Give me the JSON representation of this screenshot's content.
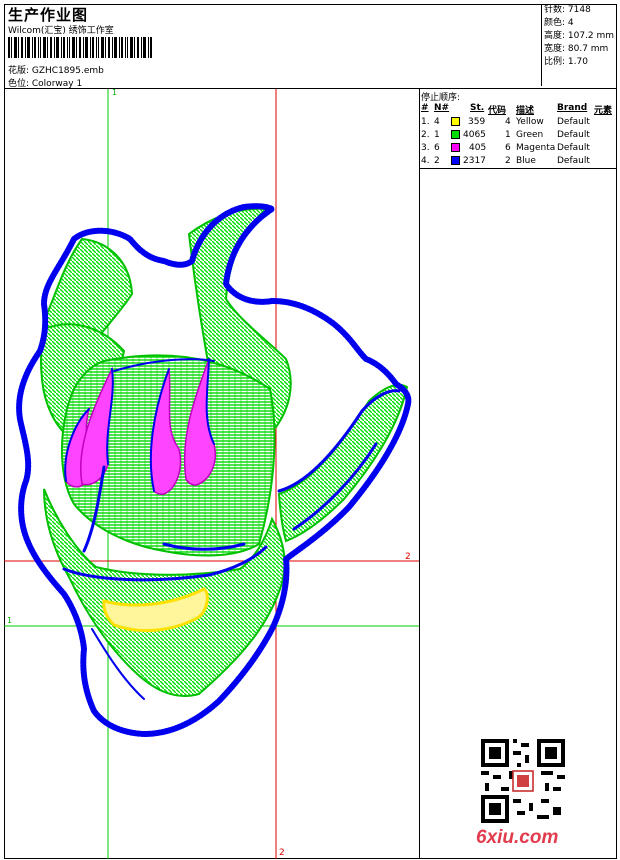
{
  "header": {
    "title": "生产作业图",
    "subtitle": "Wilcom(汇宝) 绣饰工作室",
    "design_label": "花版: GZHC1895.emb",
    "colorway_label": "色位: Colorway 1"
  },
  "stats": {
    "stitches": "针数: 7148",
    "colors": "颜色: 4",
    "height": "高度: 107.2 mm",
    "width": "宽度: 80.7 mm",
    "scale": "比例: 1.70"
  },
  "stop_sequence": {
    "title": "停止顺序:",
    "headers": [
      "#",
      "N#",
      "St.",
      "代码",
      "描述",
      "Brand",
      "元素"
    ],
    "rows": [
      {
        "idx": "1.",
        "needle": "4",
        "color": "#ffff00",
        "stitches": "359",
        "code": "4",
        "desc": "Yellow",
        "brand": "Default"
      },
      {
        "idx": "2.",
        "needle": "1",
        "color": "#00dd00",
        "stitches": "4065",
        "code": "1",
        "desc": "Green",
        "brand": "Default"
      },
      {
        "idx": "3.",
        "needle": "6",
        "color": "#ff00ff",
        "stitches": "405",
        "code": "6",
        "desc": "Magenta",
        "brand": "Default"
      },
      {
        "idx": "4.",
        "needle": "2",
        "color": "#0000ff",
        "stitches": "2317",
        "code": "2",
        "desc": "Blue",
        "brand": "Default"
      }
    ]
  },
  "guides": {
    "label_1": "1",
    "label_2": "2"
  },
  "watermark": "6xiu.com"
}
